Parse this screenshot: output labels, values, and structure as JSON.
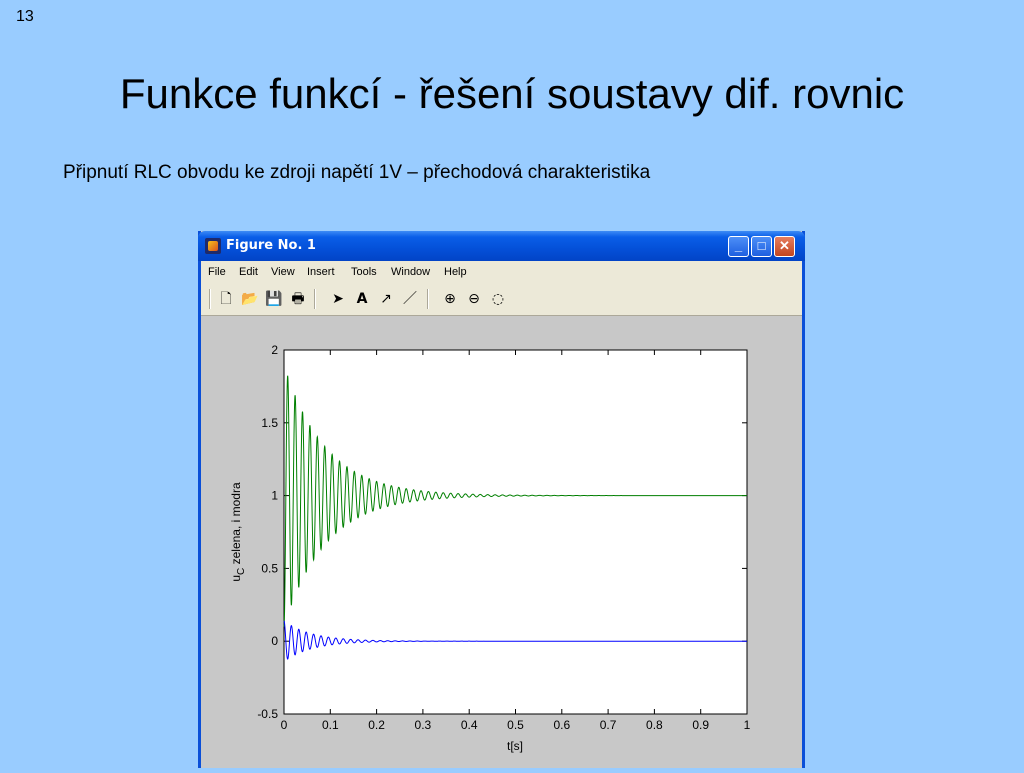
{
  "slide": {
    "number": "13",
    "title": "Funkce funkcí - řešení soustavy dif. rovnic",
    "subtitle": "Připnutí RLC obvodu ke zdroji napětí 1V – přechodová charakteristika"
  },
  "window": {
    "title": "Figure No. 1",
    "controls": {
      "minimize": "_",
      "maximize": "□",
      "close": "✕"
    },
    "menu": [
      "File",
      "Edit",
      "View",
      "Insert",
      "Tools",
      "Window",
      "Help"
    ],
    "toolbar": [
      {
        "name": "new-file-icon",
        "glyph": "🗋"
      },
      {
        "name": "open-folder-icon",
        "glyph": "📂"
      },
      {
        "name": "save-icon",
        "glyph": "💾"
      },
      {
        "name": "print-icon",
        "glyph": "🖶"
      },
      {
        "name": "select-arrow-icon",
        "glyph": "➤"
      },
      {
        "name": "insert-text-icon",
        "glyph": "A"
      },
      {
        "name": "insert-arrow-icon",
        "glyph": "↗"
      },
      {
        "name": "insert-line-icon",
        "glyph": "／"
      },
      {
        "name": "zoom-in-icon",
        "glyph": "⊕"
      },
      {
        "name": "zoom-out-icon",
        "glyph": "⊖"
      },
      {
        "name": "rotate-icon",
        "glyph": "◌"
      }
    ]
  },
  "chart_data": {
    "type": "line",
    "xlabel": "t[s]",
    "ylabel_main": "u",
    "ylabel_sub": "C",
    "ylabel_rest": " zelena, i modra",
    "xlim": [
      0,
      1
    ],
    "ylim": [
      -0.5,
      2
    ],
    "xticks": [
      "0",
      "0.1",
      "0.2",
      "0.3",
      "0.4",
      "0.5",
      "0.6",
      "0.7",
      "0.8",
      "0.9",
      "1"
    ],
    "yticks": [
      "-0.5",
      "0",
      "0.5",
      "1",
      "1.5",
      "2"
    ],
    "grid": false,
    "series": [
      {
        "color": "#007f00",
        "amplitude": 0.9,
        "offset": 1,
        "decay": 0.09,
        "period": 0.016
      },
      {
        "color": "#0000ff",
        "amplitude": 0.14,
        "offset": 0,
        "decay": 0.06,
        "period": 0.016
      }
    ]
  }
}
